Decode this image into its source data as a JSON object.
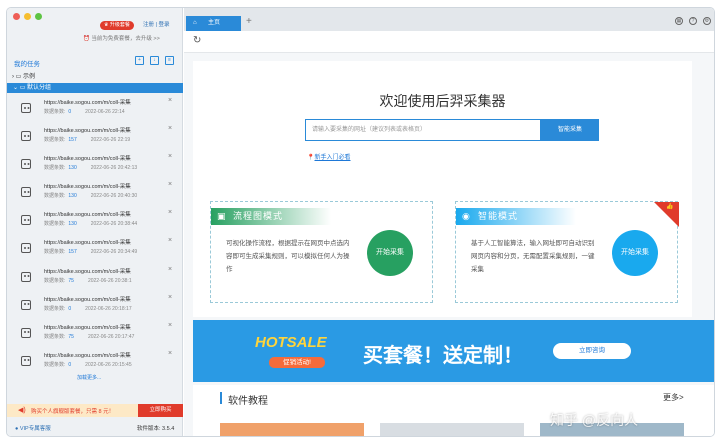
{
  "sidebar": {
    "upgrade_label": "升级套餐",
    "auth_links": "注册 | 登录",
    "free_note": "当前为免费套餐，去升级 >>",
    "my_tasks": "我的任务",
    "group_example": "示例",
    "group_default": "默认分组",
    "tasks": [
      {
        "url": "https://baike.sogou.com/m/coll-采集",
        "count_label": "数据条数:",
        "count": "0",
        "time": "2022-06-26 22:14"
      },
      {
        "url": "https://baike.sogou.com/m/coll-采集",
        "count_label": "数据条数:",
        "count": "157",
        "time": "2022-06-26 22:19"
      },
      {
        "url": "https://baike.sogou.com/m/coll-采集",
        "count_label": "数据条数:",
        "count": "130",
        "time": "2022-06-26 20:42:13"
      },
      {
        "url": "https://baike.sogou.com/m/coll-采集",
        "count_label": "数据条数:",
        "count": "130",
        "time": "2022-06-26 20:40:30"
      },
      {
        "url": "https://baike.sogou.com/m/coll-采集",
        "count_label": "数据条数:",
        "count": "130",
        "time": "2022-06-26 20:38:44"
      },
      {
        "url": "https://baike.sogou.com/m/coll-采集",
        "count_label": "数据条数:",
        "count": "157",
        "time": "2022-06-26 20:34:49"
      },
      {
        "url": "https://baike.sogou.com/m/coll-采集",
        "count_label": "数据条数:",
        "count": "75",
        "time": "2022-06-26 20:38:1"
      },
      {
        "url": "https://baike.sogou.com/m/coll-采集",
        "count_label": "数据条数:",
        "count": "0",
        "time": "2022-06-26 20:18:17"
      },
      {
        "url": "https://baike.sogou.com/m/coll-采集",
        "count_label": "数据条数:",
        "count": "75",
        "time": "2022-06-26 20:17:47"
      },
      {
        "url": "https://baike.sogou.com/m/coll-采集",
        "count_label": "数据条数:",
        "count": "0",
        "time": "2022-06-26 20:15:45"
      }
    ],
    "load_more": "加载更多...",
    "promo_text": "购买个人旗舰版套餐，只需 8 元！",
    "promo_button": "立即购买",
    "vip_link": "VIP专属客服",
    "version": "软件版本: 3.5.4"
  },
  "main": {
    "tab_label": "主页",
    "welcome": "欢迎使用后羿采集器",
    "search_placeholder": "请输入要采集的网址（建议列表或表格页）",
    "search_button": "智能采集",
    "guide_link": "新手入门必看",
    "flow_mode": {
      "title": "流程图模式",
      "desc": "可视化操作流程，根据提示在网页中点选内容即可生成采集规则，可以模拟任何人为操作",
      "button": "开始采集",
      "color": "#27a061"
    },
    "smart_mode": {
      "title": "智能模式",
      "desc": "基于人工智能算法，输入网址即可自动识别网页内容和分页，无需配置采集规则，一键采集",
      "button": "开始采集",
      "color": "#19a9ee"
    },
    "banner": {
      "hot": "HOTSALE",
      "hot_sub": "促销活动!",
      "text": "买套餐！送定制！",
      "button": "立即咨询"
    },
    "tutorial_title": "软件教程",
    "tutorial_more": "更多>",
    "watermark": "知乎 @反向人"
  },
  "colors": {
    "accent": "#2a8ad8",
    "promo_red": "#e03b2b"
  }
}
